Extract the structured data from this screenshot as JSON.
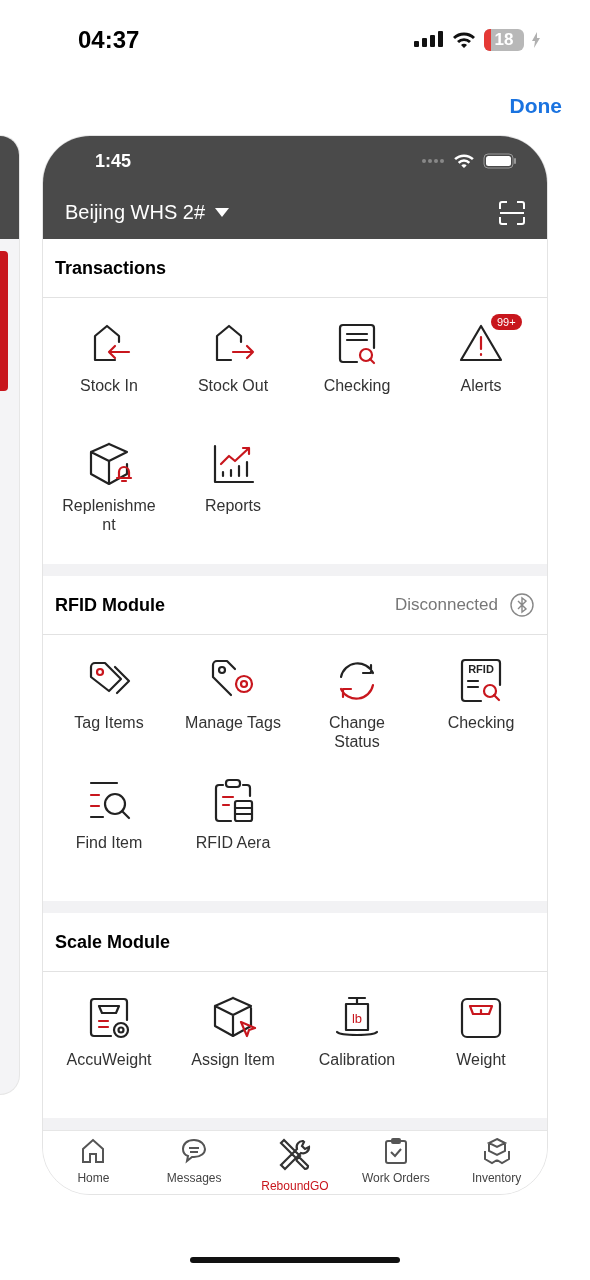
{
  "status_bar": {
    "time": "04:37",
    "battery": "18"
  },
  "done_button": "Done",
  "app": {
    "status_bar": {
      "time": "1:45"
    },
    "warehouse": "Beijing WHS 2#",
    "sections": [
      {
        "title": "Transactions",
        "items": [
          {
            "label": "Stock In"
          },
          {
            "label": "Stock Out"
          },
          {
            "label": "Checking"
          },
          {
            "label": "Alerts",
            "badge": "99+"
          },
          {
            "label": "Replenishment"
          },
          {
            "label": "Reports"
          }
        ]
      },
      {
        "title": "RFID Module",
        "status": "Disconnected",
        "items": [
          {
            "label": "Tag Items"
          },
          {
            "label": "Manage Tags"
          },
          {
            "label": "Change Status"
          },
          {
            "label": "Checking",
            "icon_text": "RFID"
          },
          {
            "label": "Find Item"
          },
          {
            "label": "RFID Aera"
          }
        ]
      },
      {
        "title": "Scale Module",
        "items": [
          {
            "label": "AccuWeight"
          },
          {
            "label": "Assign Item"
          },
          {
            "label": "Calibration",
            "icon_text": "lb"
          },
          {
            "label": "Weight"
          }
        ]
      }
    ],
    "tab_bar": [
      {
        "label": "Home",
        "selected": false
      },
      {
        "label": "Messages",
        "selected": false
      },
      {
        "label": "ReboundGO",
        "selected": true
      },
      {
        "label": "Work Orders",
        "selected": false
      },
      {
        "label": "Inventory",
        "selected": false
      }
    ]
  }
}
